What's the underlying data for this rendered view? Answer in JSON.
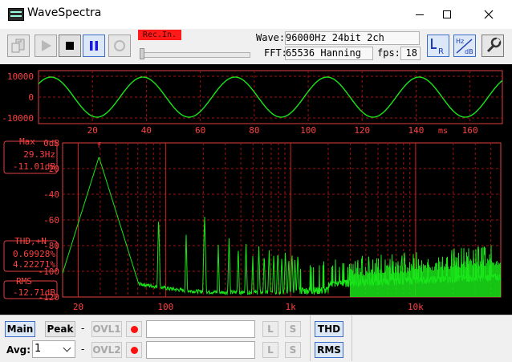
{
  "window": {
    "title": "WaveSpectra"
  },
  "toolbar": {
    "rec_label": "Rec.In.",
    "wave_label": "Wave:",
    "wave_value": "96000Hz 24bit 2ch",
    "fft_label": "FFT:",
    "fft_value": "65536 Hanning",
    "fps_label": "fps:",
    "fps_value": "18",
    "icons": [
      "import-icon",
      "play-icon",
      "stop-icon",
      "pause-icon",
      "record-icon",
      "lr-channel-icon",
      "hz-db-scale-icon",
      "settings-wrench-icon"
    ]
  },
  "oscilloscope": {
    "y_ticks": [
      "10000",
      "0",
      "-10000"
    ],
    "x_ticks": [
      "20",
      "40",
      "60",
      "80",
      "100",
      "120",
      "140",
      "160"
    ],
    "x_unit": "ms"
  },
  "spectrum": {
    "y_ticks": [
      "0dB",
      "-20",
      "-40",
      "-60",
      "-80",
      "-100",
      "-120"
    ],
    "x_ticks": [
      "20",
      "100",
      "1k",
      "10k"
    ],
    "marker_label": "f",
    "max_title": "Max",
    "max_freq": "29.3Hz",
    "max_db": "-11.01dB",
    "thd_title": "THD,+N",
    "thd_value1": "0.69928%",
    "thd_value2": "4.22271%",
    "rms_title": "RMS",
    "rms_value": "-12.71dB"
  },
  "bottom": {
    "main_label": "Main",
    "peak_label": "Peak",
    "dash": "-",
    "ovl1_label": "OVL1",
    "ovl2_label": "OVL2",
    "l_label": "L",
    "s_label": "S",
    "avg_label": "Avg:",
    "avg_value": "1",
    "thd_button": "THD",
    "rms_button": "RMS"
  },
  "colors": {
    "trace": "#19e619",
    "grid": "#a01010",
    "frame": "#e04040",
    "label": "#ff4040",
    "background": "#000000"
  }
}
